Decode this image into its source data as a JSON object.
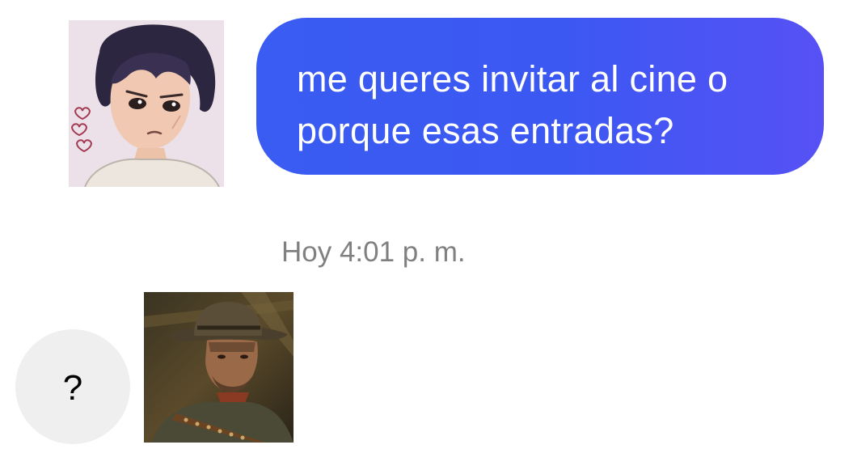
{
  "conversation": {
    "sent_message": {
      "lines": [
        "me queres invitar al cine o",
        "porque esas entradas?"
      ],
      "bubble_color": "#3c58f3"
    },
    "timestamp": "Hoy 4:01 p. m.",
    "received_message": {
      "text": "?",
      "bubble_color": "#efefef"
    }
  },
  "images": {
    "sent_image": "anime-girl-portrait-sticker",
    "received_image": "cowboy-portrait-photo"
  }
}
